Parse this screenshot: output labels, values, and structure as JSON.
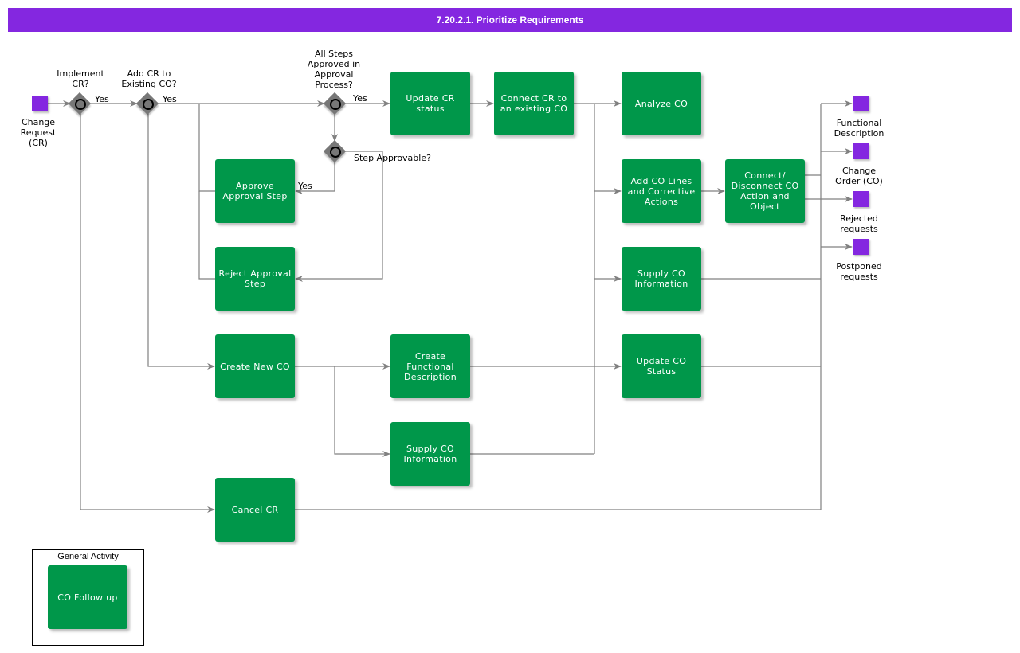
{
  "header": {
    "title": "7.20.2.1. Prioritize Requirements"
  },
  "colors": {
    "title_bar": "#8427e0",
    "task": "#00974a",
    "event": "#8427e0",
    "gateway": "#777777",
    "connector": "#808080"
  },
  "start_event": {
    "label": "Change\nRequest\n(CR)"
  },
  "gateways": {
    "implement_cr": {
      "label": "Implement\nCR?",
      "branch_label": "Yes"
    },
    "add_to_existing_co": {
      "label": "Add CR to\nExisting CO?",
      "branch_label": "Yes"
    },
    "all_steps_approved": {
      "label": "All Steps\nApproved in\nApproval\nProcess?",
      "branch_label": "Yes"
    },
    "step_approvable": {
      "label": "Step Approvable?",
      "branch_label": "Yes"
    }
  },
  "tasks": {
    "update_cr_status": "Update CR\nstatus",
    "connect_cr_existing_co": "Connect CR to\nan existing CO",
    "analyze_co": "Analyze CO",
    "approve_approval_step": "Approve\nApproval Step",
    "reject_approval_step": "Reject Approval\nStep",
    "add_co_lines": "Add CO Lines\nand Corrective\nActions",
    "connect_disconnect_co": "Connect/\nDisconnect CO\nAction and\nObject",
    "supply_co_information_1": "Supply CO\nInformation",
    "create_new_co": "Create New CO",
    "create_functional_description": "Create\nFunctional\nDescription",
    "update_co_status": "Update CO\nStatus",
    "supply_co_information_2": "Supply CO\nInformation",
    "cancel_cr": "Cancel CR"
  },
  "end_events": [
    {
      "label": "Functional\nDescription"
    },
    {
      "label": "Change\nOrder (CO)"
    },
    {
      "label": "Rejected\nrequests"
    },
    {
      "label": "Postponed\nrequests"
    }
  ],
  "legend": {
    "title": "General Activity",
    "task": "CO Follow up"
  }
}
